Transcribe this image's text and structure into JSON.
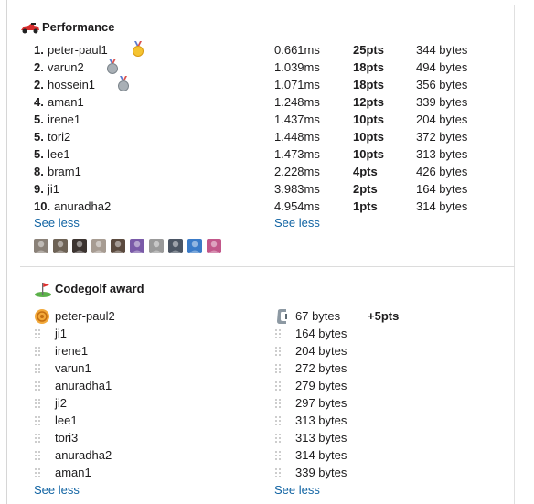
{
  "performance": {
    "title": "Performance",
    "icon": "race-car-icon",
    "rows": [
      {
        "rank": "1.",
        "name": "peter-paul1",
        "time": "0.661ms",
        "pts": "25pts",
        "bytes": "344 bytes",
        "medal": "gold-medal-icon"
      },
      {
        "rank": "2.",
        "name": "varun2",
        "time": "1.039ms",
        "pts": "18pts",
        "bytes": "494 bytes",
        "medal": "silver-medal-icon"
      },
      {
        "rank": "2.",
        "name": "hossein1",
        "time": "1.071ms",
        "pts": "18pts",
        "bytes": "356 bytes",
        "medal": "silver-medal-icon"
      },
      {
        "rank": "4.",
        "name": "aman1",
        "time": "1.248ms",
        "pts": "12pts",
        "bytes": "339 bytes"
      },
      {
        "rank": "5.",
        "name": "irene1",
        "time": "1.437ms",
        "pts": "10pts",
        "bytes": "204 bytes"
      },
      {
        "rank": "5.",
        "name": "tori2",
        "time": "1.448ms",
        "pts": "10pts",
        "bytes": "372 bytes"
      },
      {
        "rank": "5.",
        "name": "lee1",
        "time": "1.473ms",
        "pts": "10pts",
        "bytes": "313 bytes"
      },
      {
        "rank": "8.",
        "name": "bram1",
        "time": "2.228ms",
        "pts": "4pts",
        "bytes": "426 bytes"
      },
      {
        "rank": "9.",
        "name": "ji1",
        "time": "3.983ms",
        "pts": "2pts",
        "bytes": "164 bytes"
      },
      {
        "rank": "10.",
        "name": "anuradha2",
        "time": "4.954ms",
        "pts": "1pts",
        "bytes": "314 bytes"
      }
    ],
    "see_less_left": "See less",
    "see_less_right": "See less",
    "avatar_colors": [
      "#8a8178",
      "#6d6255",
      "#3c3430",
      "#a79c92",
      "#5b4a3e",
      "#7a5aa8",
      "#9a9a9a",
      "#4b5563",
      "#3a7bc8",
      "#c2578a"
    ]
  },
  "codegolf": {
    "title": "Codegolf award",
    "icon": "golf-flag-icon",
    "winner": {
      "name": "peter-paul2",
      "bytes": "67 bytes",
      "pts": "+5pts",
      "icon": "award-badge-icon",
      "bytes_icon": "trophy-clamp-icon"
    },
    "rows": [
      {
        "name": "ji1",
        "bytes": "164 bytes"
      },
      {
        "name": "irene1",
        "bytes": "204 bytes"
      },
      {
        "name": "varun1",
        "bytes": "272 bytes"
      },
      {
        "name": "anuradha1",
        "bytes": "279 bytes"
      },
      {
        "name": "ji2",
        "bytes": "297 bytes"
      },
      {
        "name": "lee1",
        "bytes": "313 bytes"
      },
      {
        "name": "tori3",
        "bytes": "313 bytes"
      },
      {
        "name": "anuradha2",
        "bytes": "314 bytes"
      },
      {
        "name": "aman1",
        "bytes": "339 bytes"
      }
    ],
    "see_less_left": "See less",
    "see_less_right": "See less"
  },
  "colors": {
    "link": "#1264a3",
    "text": "#1d1c1d",
    "divider": "#dcdcdc"
  }
}
